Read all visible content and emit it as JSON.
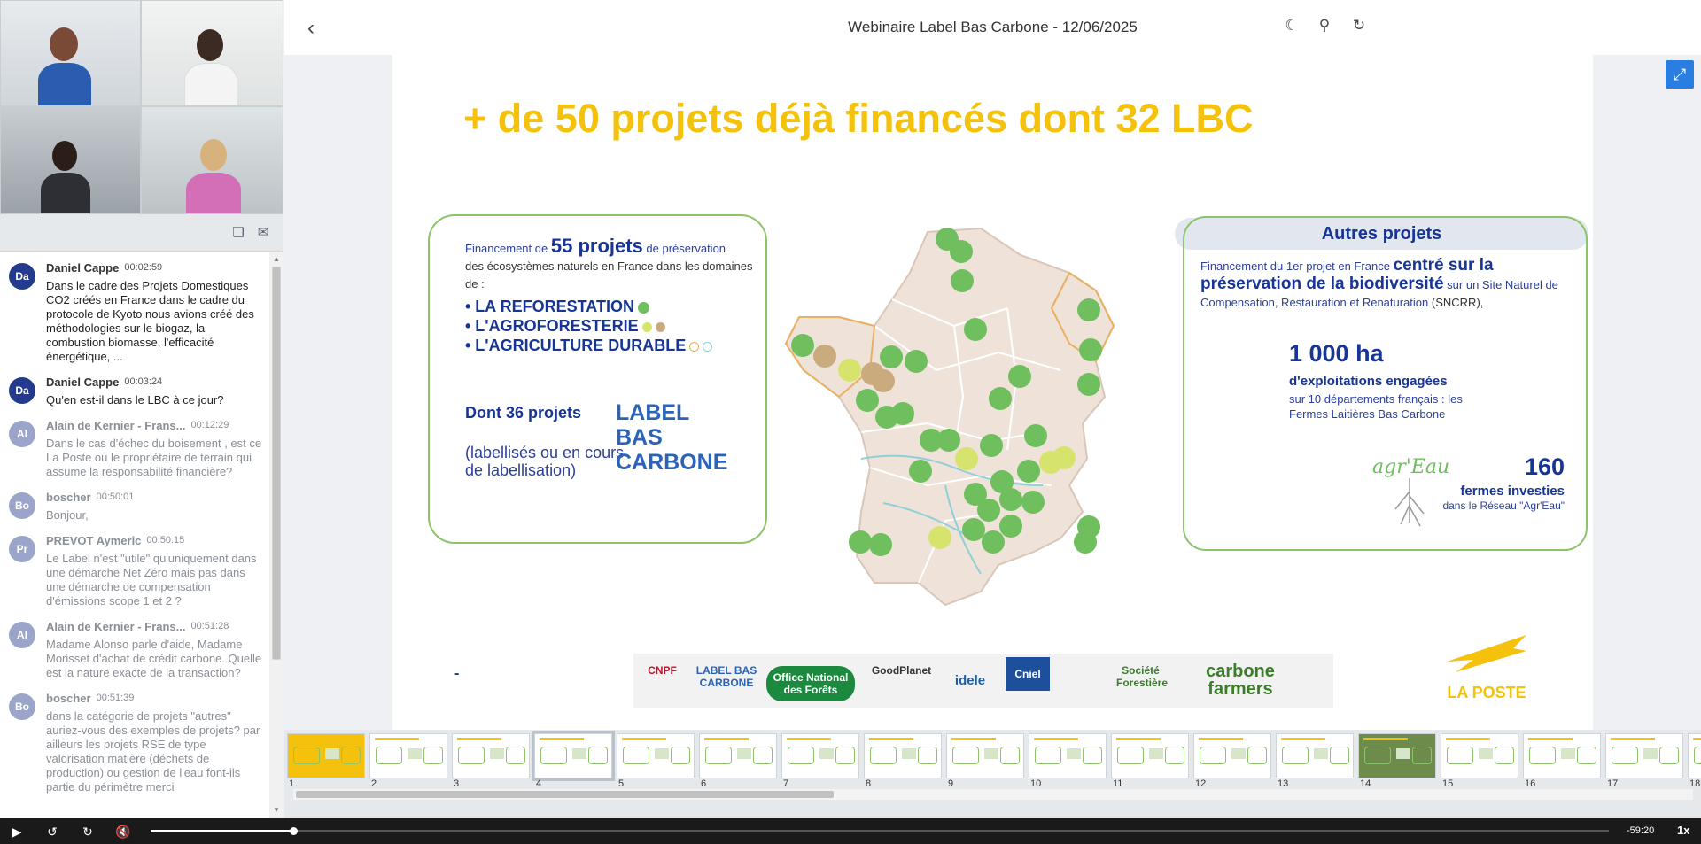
{
  "window": {
    "title": "Webinaire Label Bas Carbone - 12/06/2025"
  },
  "chat": {
    "messages": [
      {
        "initials": "Da",
        "name": "Daniel Cappe",
        "time": "00:02:59",
        "text": "Dans le cadre des Projets Domestiques CO2 créés en France dans le cadre du protocole de Kyoto nous avions créé des méthodologies sur le biogaz, la combustion biomasse, l'efficacité énergétique, ...",
        "style": "dark"
      },
      {
        "initials": "Da",
        "name": "Daniel Cappe",
        "time": "00:03:24",
        "text": "Qu'en est-il dans le LBC à ce jour?",
        "style": "dark"
      },
      {
        "initials": "Al",
        "name": "Alain de Kernier - Frans...",
        "time": "00:12:29",
        "text": "Dans le cas d'échec du boisement , est ce La Poste ou le propriétaire de terrain qui assume la responsabilité financière?",
        "style": "light"
      },
      {
        "initials": "Bo",
        "name": "boscher",
        "time": "00:50:01",
        "text": "Bonjour,",
        "style": "light"
      },
      {
        "initials": "Pr",
        "name": "PREVOT Aymeric",
        "time": "00:50:15",
        "text": "Le Label n'est \"utile\" qu'uniquement dans une démarche Net Zéro mais pas dans une démarche de compensation d'émissions scope 1 et 2 ?",
        "style": "light"
      },
      {
        "initials": "Al",
        "name": "Alain de Kernier - Frans...",
        "time": "00:51:28",
        "text": "Madame Alonso parle d'aide, Madame Morisset d'achat de crédit carbone. Quelle est la nature exacte de la transaction?",
        "style": "light"
      },
      {
        "initials": "Bo",
        "name": "boscher",
        "time": "00:51:39",
        "text": "dans la catégorie de projets \"autres\" auriez-vous des exemples de projets? par ailleurs les projets RSE de type valorisation matière (déchets de production) ou gestion de l'eau font-ils partie du périmètre merci",
        "style": "light"
      }
    ]
  },
  "slide": {
    "title": "+ de 50 projets déjà financés dont 32 LBC",
    "left_box": {
      "intro_prefix": "Financement de",
      "intro_big": "55 projets",
      "intro_suffix": "de préservation",
      "intro_line2": "des écosystèmes naturels en France dans les domaines de :",
      "bullet1": "• LA REFORESTATION",
      "bullet2": "• L'AGROFORESTERIE",
      "bullet3": "• L'AGRICULTURE DURABLE",
      "dont36": "Dont 36 projets",
      "labellises": "(labellisés ou en cours de labellisation)",
      "logo_line1": "LABEL BAS",
      "logo_line2": "CARBONE"
    },
    "right_box": {
      "header": "Autres projets",
      "p1_prefix": "Financement du",
      "p1_mid": "1er projet en France",
      "p1_bold": "centré sur la préservation de la biodiversité",
      "p1_suffix": "sur un Site Naturel de Compensation, Restauration et Renaturation",
      "p1_abbr": "(SNCRR),",
      "ha": "1 000 ha",
      "ha_sub": "d'exploitations engagées",
      "ha_desc": "sur 10 départements français : les Fermes Laitières Bas Carbone",
      "n160": "160",
      "fermes": "fermes investies",
      "reseau": "dans le Réseau \"Agr'Eau\"",
      "agreau_logo": "agr'Eau"
    },
    "dash": "-",
    "partners": [
      {
        "name": "CNPF",
        "color": "#c8102e"
      },
      {
        "name": "LABEL BAS CARBONE",
        "color": "#2b63b8"
      },
      {
        "name": "Office National des Forêts",
        "color": "#ffffff"
      },
      {
        "name": "GoodPlanet",
        "color": "#333333"
      },
      {
        "name": "idele",
        "color": "#1d5fa8"
      },
      {
        "name": "Cniel",
        "color": "#ffffff"
      },
      {
        "name": "",
        "color": "#3a7d2c"
      },
      {
        "name": "Société Forestière",
        "color": "#3a7d2c"
      },
      {
        "name": "carbone farmers",
        "color": "#3b7d2a"
      }
    ],
    "laposte": "LA POSTE"
  },
  "thumbnails": [
    "1",
    "2",
    "3",
    "4",
    "5",
    "6",
    "7",
    "8",
    "9",
    "10",
    "11",
    "12",
    "13",
    "14",
    "15",
    "16",
    "17",
    "18"
  ],
  "active_thumbnail": 4,
  "player": {
    "time_remaining": "-59:20",
    "speed": "1x",
    "progress_fraction": 0.098
  },
  "colors": {
    "accent_yellow": "#f4c20d",
    "navy": "#173595",
    "green": "#8cc46a",
    "map_dot_green": "#6fbf5f",
    "map_dot_yellow": "#d6e46d"
  },
  "icons": {
    "back": "chevron-left-icon",
    "theme": "moon-icon",
    "search": "search-icon",
    "sync": "refresh-icon",
    "fullscreen": "expand-icon"
  }
}
